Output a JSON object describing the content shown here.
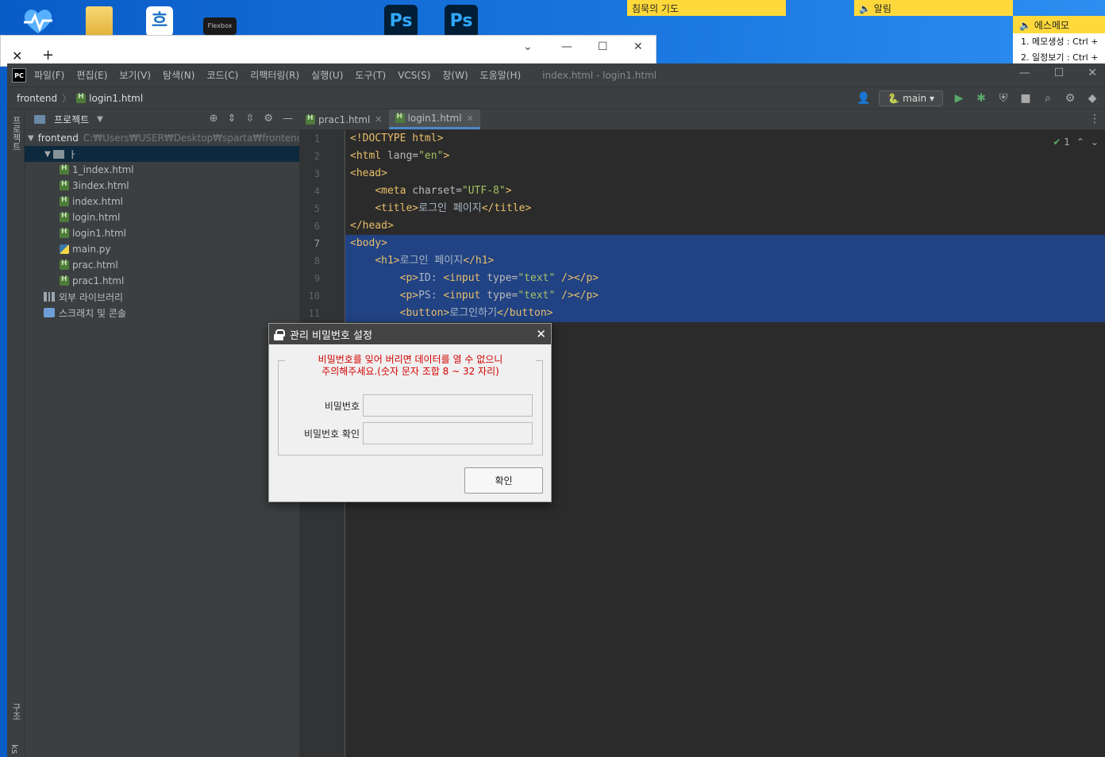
{
  "desktop": {
    "flexbox_label": "Flexbox",
    "ps_label": "Ps",
    "app_glyph": "흐",
    "sticky_prayer": "침묵의 기도",
    "sticky_alarm": "알림",
    "memo_title": "에스메모",
    "memo_line1": "1. 메모생성 : Ctrl +",
    "memo_line2": "2. 일정보기 : Ctrl +"
  },
  "ide": {
    "logo": "PC",
    "menu": [
      "파일(F)",
      "편집(E)",
      "보기(V)",
      "탐색(N)",
      "코드(C)",
      "리팩터링(R)",
      "실행(U)",
      "도구(T)",
      "VCS(S)",
      "창(W)",
      "도움말(H)"
    ],
    "window_title": "index.html - login1.html",
    "breadcrumb_root": "frontend",
    "breadcrumb_file": "login1.html",
    "run_config": "main",
    "left_strip_project": "프로젝트",
    "left_strip_structure": "구조",
    "left_strip_bookmarks": "ks"
  },
  "project": {
    "title": "프로젝트",
    "root_name": "frontend",
    "root_path": "C:₩Users₩USER₩Desktop₩sparta₩frontend",
    "subfolder": "ㅏ",
    "files": [
      "1_index.html",
      "3index.html",
      "index.html",
      "login.html",
      "login1.html",
      "main.py",
      "prac.html",
      "prac1.html"
    ],
    "external_libs": "외부 라이브러리",
    "scratches": "스크래치 및 콘솔"
  },
  "editor": {
    "tabs": [
      "prac1.html",
      "login1.html"
    ],
    "inspection_count": "1",
    "line_numbers": [
      "1",
      "2",
      "3",
      "4",
      "5",
      "6",
      "7",
      "8",
      "9",
      "10",
      "11"
    ],
    "code": {
      "l1": "<!DOCTYPE html>",
      "l2_tag": "<html ",
      "l2_attr": "lang=",
      "l2_str": "\"en\"",
      "l2_end": ">",
      "l3": "<head>",
      "l4_tag": "<meta ",
      "l4_attr": "charset=",
      "l4_str": "\"UTF-8\"",
      "l4_end": ">",
      "l5_open": "<title>",
      "l5_text": "로그인 페이지",
      "l5_close": "</title>",
      "l6": "</head>",
      "l7": "<body>",
      "l8_open": "<h1>",
      "l8_text": "로그인 페이지",
      "l8_close": "</h1>",
      "l9_a": "<p>",
      "l9_text": "ID: ",
      "l9_tag": "<input ",
      "l9_attr": "type=",
      "l9_str": "\"text\"",
      "l9_end": " /></p>",
      "l10_a": "<p>",
      "l10_text": "PS: ",
      "l10_tag": "<input ",
      "l10_attr": "type=",
      "l10_str": "\"text\"",
      "l10_end": " /></p>",
      "l11_open": "<button>",
      "l11_text": "로그인하기",
      "l11_close": "</button>"
    }
  },
  "dialog": {
    "title": "관리 비밀번호 설정",
    "message_line1": "비밀번호를 잊어 버리면 데이터를 열 수 없으니",
    "message_line2": "주의해주세요.(숫자 문자 조합 8 ~ 32 자리)",
    "password_label": "비밀번호",
    "confirm_label": "비밀번호 확인",
    "password_value": "",
    "confirm_value": "",
    "ok_button": "확인"
  }
}
